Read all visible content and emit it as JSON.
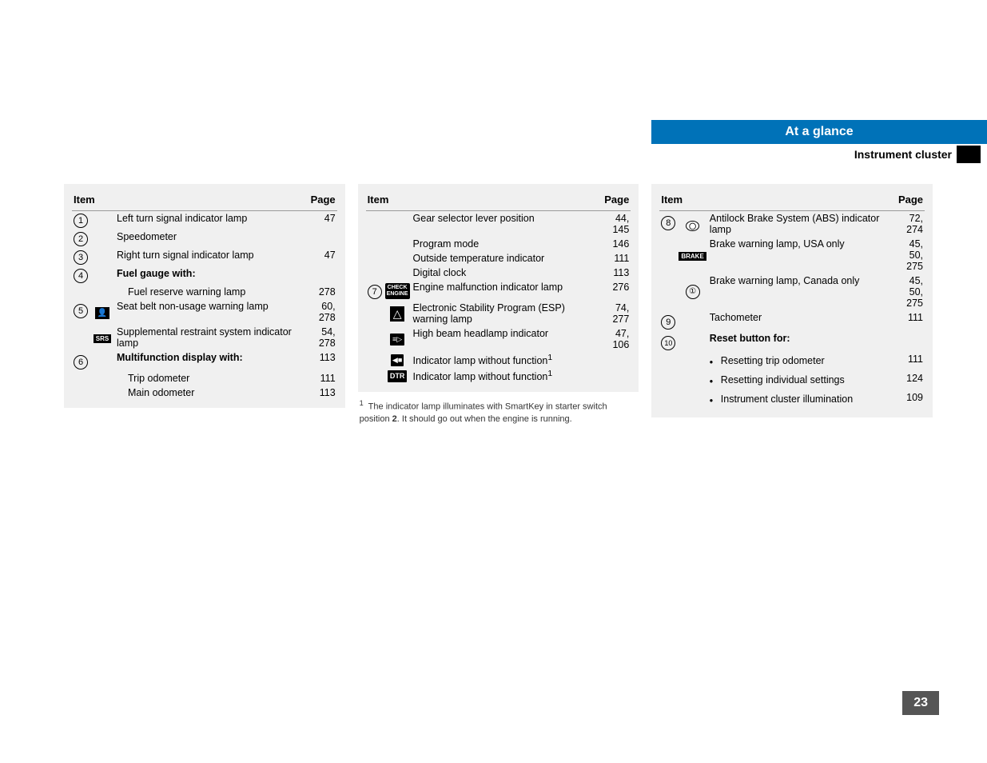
{
  "header": {
    "at_a_glance": "At a glance",
    "instrument_cluster": "Instrument cluster"
  },
  "page_number": "23",
  "col1": {
    "header_item": "Item",
    "header_page": "Page",
    "rows": [
      {
        "num": "1",
        "icon": "",
        "item": "Left turn signal indicator lamp",
        "page": "47"
      },
      {
        "num": "2",
        "icon": "",
        "item": "Speedometer",
        "page": ""
      },
      {
        "num": "3",
        "icon": "",
        "item": "Right turn signal indicator lamp",
        "page": "47"
      },
      {
        "num": "4",
        "icon": "",
        "item": "Fuel gauge with:",
        "page": "",
        "bold": true
      },
      {
        "num": "",
        "icon": "",
        "item": "Fuel reserve warning lamp",
        "page": "278"
      },
      {
        "num": "5",
        "icon": "seatbelt",
        "item": "Seat belt non-usage warning lamp",
        "page": "60,\n278"
      },
      {
        "num": "",
        "icon": "srs",
        "item": "Supplemental restraint system indicator lamp",
        "page": "54,\n278"
      },
      {
        "num": "6",
        "icon": "",
        "item": "Multifunction display with:",
        "page": "113",
        "bold": true
      },
      {
        "num": "",
        "icon": "",
        "item": "Trip odometer",
        "page": "111"
      },
      {
        "num": "",
        "icon": "",
        "item": "Main odometer",
        "page": "113"
      }
    ]
  },
  "col2": {
    "header_item": "Item",
    "header_page": "Page",
    "rows": [
      {
        "num": "",
        "icon": "",
        "item": "Gear selector lever position",
        "page": "44,\n145"
      },
      {
        "num": "",
        "icon": "",
        "item": "Program mode",
        "page": "146"
      },
      {
        "num": "",
        "icon": "",
        "item": "Outside temperature indicator",
        "page": "111"
      },
      {
        "num": "",
        "icon": "",
        "item": "Digital clock",
        "page": "113"
      },
      {
        "num": "7",
        "icon": "check-engine",
        "item": "Engine malfunction indicator lamp",
        "page": "276"
      },
      {
        "num": "",
        "icon": "triangle",
        "item": "Electronic Stability Program (ESP) warning lamp",
        "page": "74,\n277"
      },
      {
        "num": "",
        "icon": "highbeam",
        "item": "High beam headlamp indicator",
        "page": "47,\n106"
      },
      {
        "num": "",
        "icon": "radio",
        "item": "Indicator lamp without function¹",
        "page": ""
      },
      {
        "num": "",
        "icon": "dtr",
        "item": "Indicator lamp without function¹",
        "page": ""
      }
    ],
    "footnote": "¹  The indicator lamp illuminates with SmartKey in starter switch position 2. It should go out when the engine is running."
  },
  "col3": {
    "header_item": "Item",
    "header_page": "Page",
    "rows": [
      {
        "num": "8",
        "icon": "abs",
        "item": "Antilock Brake System (ABS) indicator lamp",
        "page": "72,\n274"
      },
      {
        "num": "",
        "icon": "brake-text",
        "item": "Brake warning lamp, USA only",
        "page": "45,\n50,\n275"
      },
      {
        "num": "",
        "icon": "brake-circle",
        "item": "Brake warning lamp, Canada only",
        "page": "45,\n50,\n275"
      },
      {
        "num": "9",
        "icon": "",
        "item": "Tachometer",
        "page": "111"
      },
      {
        "num": "10",
        "icon": "",
        "item": "Reset button for:",
        "page": "",
        "bold": true
      },
      {
        "num": "",
        "icon": "",
        "item": "• Resetting trip odometer",
        "page": "111",
        "bullet": true
      },
      {
        "num": "",
        "icon": "",
        "item": "• Resetting individual settings",
        "page": "124",
        "bullet": true
      },
      {
        "num": "",
        "icon": "",
        "item": "• Instrument cluster illumination",
        "page": "109",
        "bullet": true
      }
    ]
  }
}
